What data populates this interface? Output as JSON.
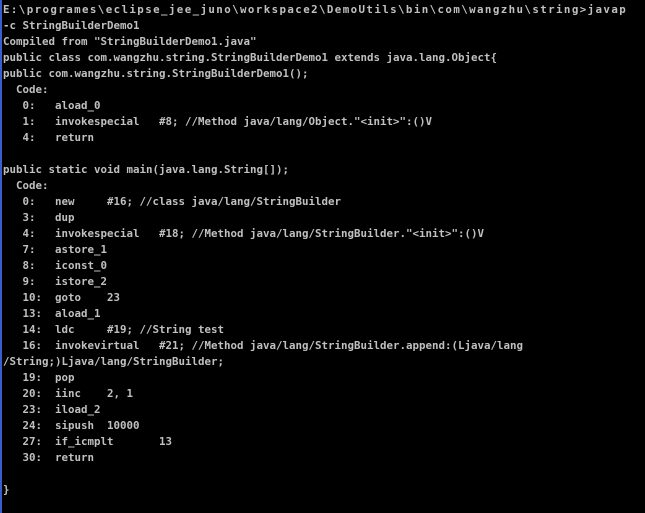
{
  "console": {
    "background": "#000000",
    "text_color": "#c0c0c0",
    "lines": [
      "E:\\programes\\eclipse_jee_juno\\workspace2\\DemoUtils\\bin\\com\\wangzhu\\string>javap",
      "-c StringBuilderDemo1",
      "Compiled from \"StringBuilderDemo1.java\"",
      "public class com.wangzhu.string.StringBuilderDemo1 extends java.lang.Object{",
      "public com.wangzhu.string.StringBuilderDemo1();",
      "  Code:",
      "   0:   aload_0",
      "   1:   invokespecial   #8; //Method java/lang/Object.\"<init>\":()V",
      "   4:   return",
      "",
      "public static void main(java.lang.String[]);",
      "  Code:",
      "   0:   new     #16; //class java/lang/StringBuilder",
      "   3:   dup",
      "   4:   invokespecial   #18; //Method java/lang/StringBuilder.\"<init>\":()V",
      "   7:   astore_1",
      "   8:   iconst_0",
      "   9:   istore_2",
      "   10:  goto    23",
      "   13:  aload_1",
      "   14:  ldc     #19; //String test",
      "   16:  invokevirtual   #21; //Method java/lang/StringBuilder.append:(Ljava/lang",
      "/String;)Ljava/lang/StringBuilder;",
      "   19:  pop",
      "   20:  iinc    2, 1",
      "   23:  iload_2",
      "   24:  sipush  10000",
      "   27:  if_icmplt       13",
      "   30:  return",
      "",
      "}"
    ]
  }
}
